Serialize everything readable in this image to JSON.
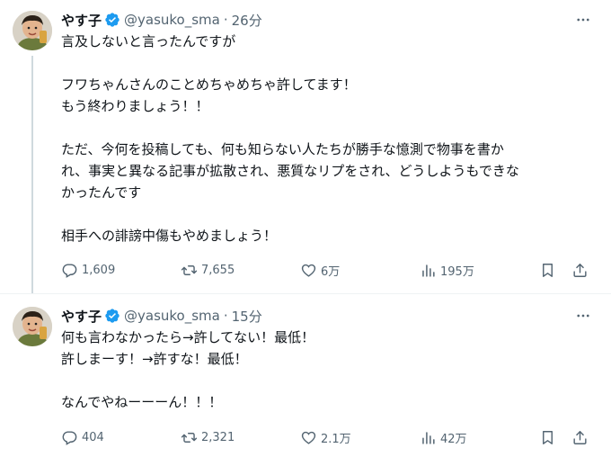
{
  "colors": {
    "text": "#0f1419",
    "secondary": "#536471",
    "verified": "#1d9bf0",
    "divider": "#eff3f4",
    "thread_line": "#cfd9de"
  },
  "icons": [
    "more-icon",
    "verified-icon",
    "reply-icon",
    "retweet-icon",
    "like-icon",
    "views-icon",
    "bookmark-icon",
    "share-icon"
  ],
  "tweets": [
    {
      "display_name": "やす子",
      "handle": "@yasuko_sma",
      "separator": "·",
      "time": "26分",
      "text": "言及しないと言ったんですが\n\nフワちゃんさんのことめちゃめちゃ許してます！\nもう終わりましょう！！\n\nただ、今何を投稿しても、何も知らない人たちが勝手な憶測で物事を書か\nれ、事実と異なる記事が拡散され、悪質なリプをされ、どうしようもできな\nかったんです\n\n相手への誹謗中傷もやめましょう！",
      "stats": {
        "replies": "1,609",
        "retweets": "7,655",
        "likes": "6万",
        "views": "195万"
      }
    },
    {
      "display_name": "やす子",
      "handle": "@yasuko_sma",
      "separator": "·",
      "time": "15分",
      "text": "何も言わなかったら→許してない！最低！\n許しまーす！→許すな！最低！\n\nなんでやねーーーん！！！",
      "stats": {
        "replies": "404",
        "retweets": "2,321",
        "likes": "2.1万",
        "views": "42万"
      }
    }
  ]
}
